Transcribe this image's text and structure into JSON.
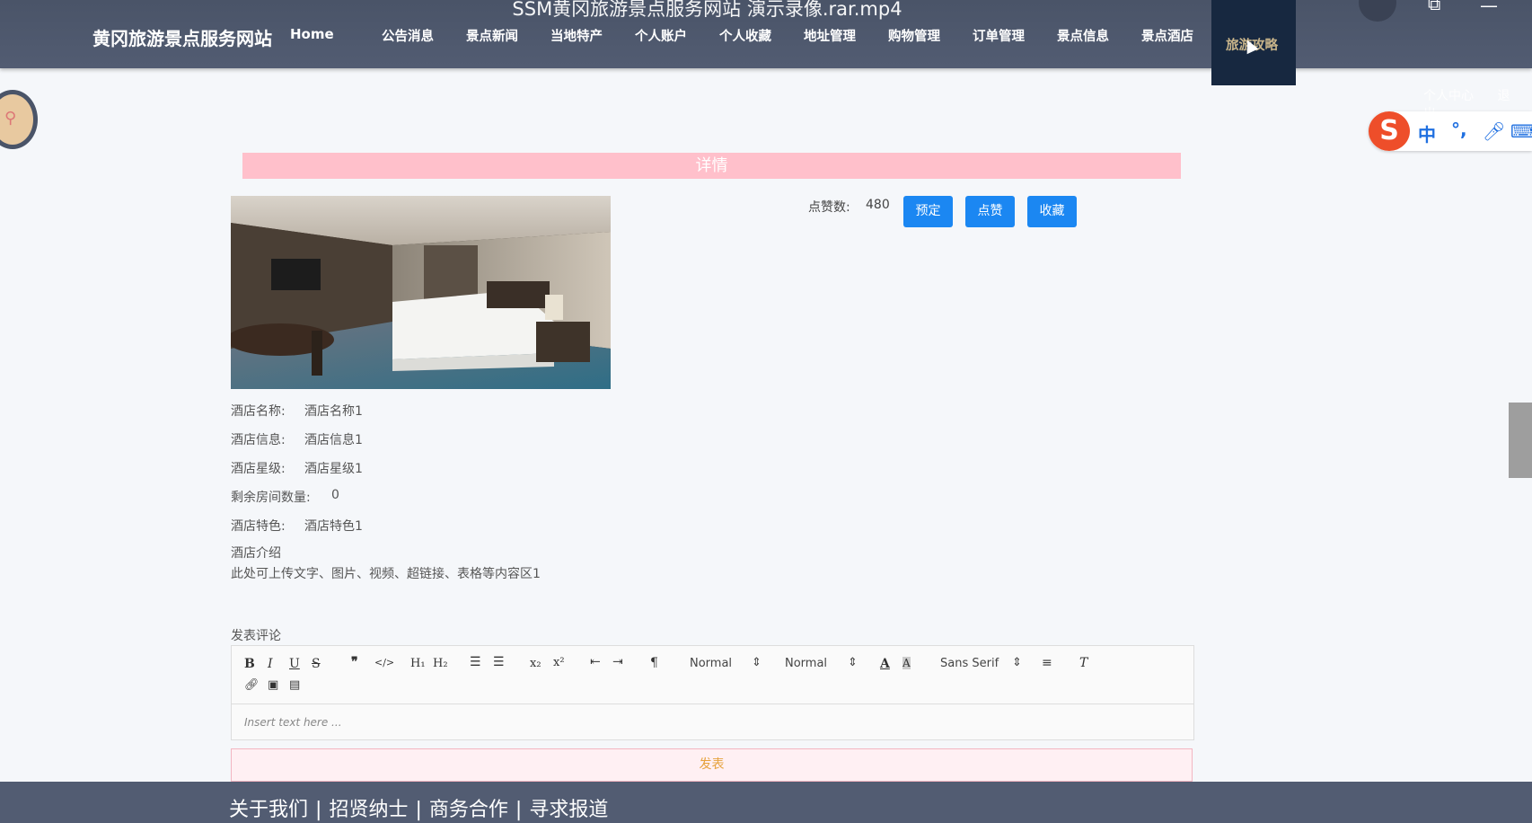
{
  "video_title": "SSM黄冈旅游景点服务网站 演示录像.rar.mp4",
  "site_name": "黄冈旅游景点服务网站",
  "nav": [
    {
      "label": "Home"
    },
    {
      "label": "公告消息"
    },
    {
      "label": "景点新闻"
    },
    {
      "label": "当地特产"
    },
    {
      "label": "个人账户"
    },
    {
      "label": "个人收藏"
    },
    {
      "label": "地址管理"
    },
    {
      "label": "购物管理"
    },
    {
      "label": "订单管理"
    },
    {
      "label": "景点信息"
    },
    {
      "label": "景点酒店"
    }
  ],
  "nav_active": {
    "label": "旅游攻略"
  },
  "user_links": {
    "center": "个人中心",
    "logout": "退出"
  },
  "ime": {
    "logo": "S",
    "lang": "中",
    "punct": "°,"
  },
  "detail": {
    "title": "详情",
    "likes_label": "点赞数:",
    "likes_value": "480",
    "buttons": {
      "reserve": "预定",
      "like": "点赞",
      "favorite": "收藏"
    }
  },
  "info": {
    "name_label": "酒店名称:",
    "name_value": "酒店名称1",
    "desc_label": "酒店信息:",
    "desc_value": "酒店信息1",
    "star_label": "酒店星级:",
    "star_value": "酒店星级1",
    "rooms_label": "剩余房间数量:",
    "rooms_value": "0",
    "feature_label": "酒店特色:",
    "feature_value": "酒店特色1",
    "intro_label": "酒店介绍",
    "intro_value": "此处可上传文字、图片、视频、超链接、表格等内容区1"
  },
  "comment": {
    "label": "发表评论",
    "toolbar": {
      "header_select": "Normal",
      "size_select": "Normal",
      "font_select": "Sans Serif"
    },
    "placeholder": "Insert text here ...",
    "submit": "发表"
  },
  "footer": [
    "关于我们",
    "招贤纳士",
    "商务合作",
    "寻求报道"
  ],
  "colors": {
    "header_bg": "#4f5970",
    "active_nav_bg": "#172840",
    "active_nav_text": "#c8b48a",
    "detail_bar": "#ffc0cb",
    "button_blue": "#1b87f2",
    "submit_text": "#e6a23c"
  }
}
